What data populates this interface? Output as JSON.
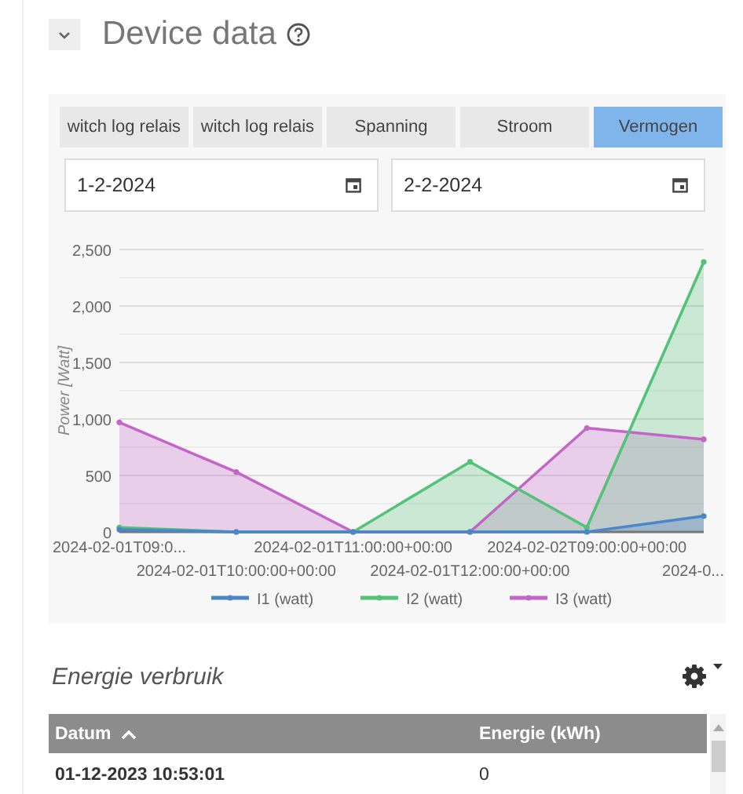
{
  "section": {
    "title": "Device data",
    "expanded": true
  },
  "tabs": [
    {
      "label": "witch log relais",
      "selected": false
    },
    {
      "label": "witch log relais",
      "selected": false
    },
    {
      "label": "Spanning",
      "selected": false
    },
    {
      "label": "Stroom",
      "selected": false
    },
    {
      "label": "Vermogen",
      "selected": true
    }
  ],
  "date_range": {
    "from": "1-2-2024",
    "to": "2-2-2024"
  },
  "chart_data": {
    "type": "area",
    "grid": true,
    "legend": true,
    "ylabel": "Power [Watt]",
    "categories": [
      "2024-02-01T09:0...",
      "2024-02-01T10:00:00+00:00",
      "2024-02-01T11:00:00+00:00",
      "2024-02-01T12:00:00+00:00",
      "2024-02-02T09:00:00+00:00",
      "2024-0..."
    ],
    "ylim": [
      0,
      2500
    ],
    "yticks": [
      {
        "value": 0,
        "label": "0"
      },
      {
        "value": 500,
        "label": "500"
      },
      {
        "value": 1000,
        "label": "1,000"
      },
      {
        "value": 1500,
        "label": "1,500"
      },
      {
        "value": 2000,
        "label": "2,000"
      },
      {
        "value": 2500,
        "label": "2,500"
      }
    ],
    "series": [
      {
        "name": "I1 (watt)",
        "color": "#4a86c8",
        "values": [
          20,
          0,
          0,
          0,
          0,
          140
        ]
      },
      {
        "name": "I2 (watt)",
        "color": "#55c27a",
        "values": [
          40,
          0,
          0,
          620,
          40,
          2390
        ]
      },
      {
        "name": "I3 (watt)",
        "color": "#c466c8",
        "values": [
          970,
          530,
          0,
          0,
          920,
          820
        ]
      }
    ]
  },
  "table": {
    "title": "Energie verbruik",
    "columns": [
      {
        "label": "Datum",
        "sorted": true
      },
      {
        "label": "Energie (kWh)",
        "sorted": false
      }
    ],
    "rows": [
      [
        "01-12-2023 10:53:01",
        "0"
      ]
    ]
  }
}
